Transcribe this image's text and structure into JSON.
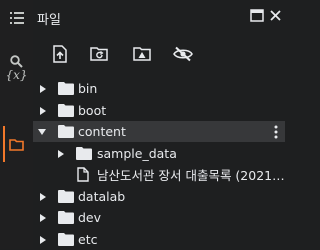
{
  "panel": {
    "title": "파일"
  },
  "rail": {
    "items": [
      "table-of-contents",
      "search",
      "variables",
      "files"
    ]
  },
  "toolbar": {
    "buttons": [
      "upload",
      "new-folder-refresh",
      "mount-drive",
      "hide-files"
    ]
  },
  "tree": {
    "rows": [
      {
        "label": "bin"
      },
      {
        "label": "boot"
      },
      {
        "label": "content"
      },
      {
        "label": "sample_data"
      },
      {
        "label": "남산도서관 장서 대출목록 (2021…"
      },
      {
        "label": "datalab"
      },
      {
        "label": "dev"
      },
      {
        "label": "etc"
      }
    ]
  },
  "rail_labels": {
    "variables": "{x}"
  },
  "colors": {
    "accent": "#f2782a",
    "background": "#1e1f20",
    "selected": "#37383a"
  }
}
